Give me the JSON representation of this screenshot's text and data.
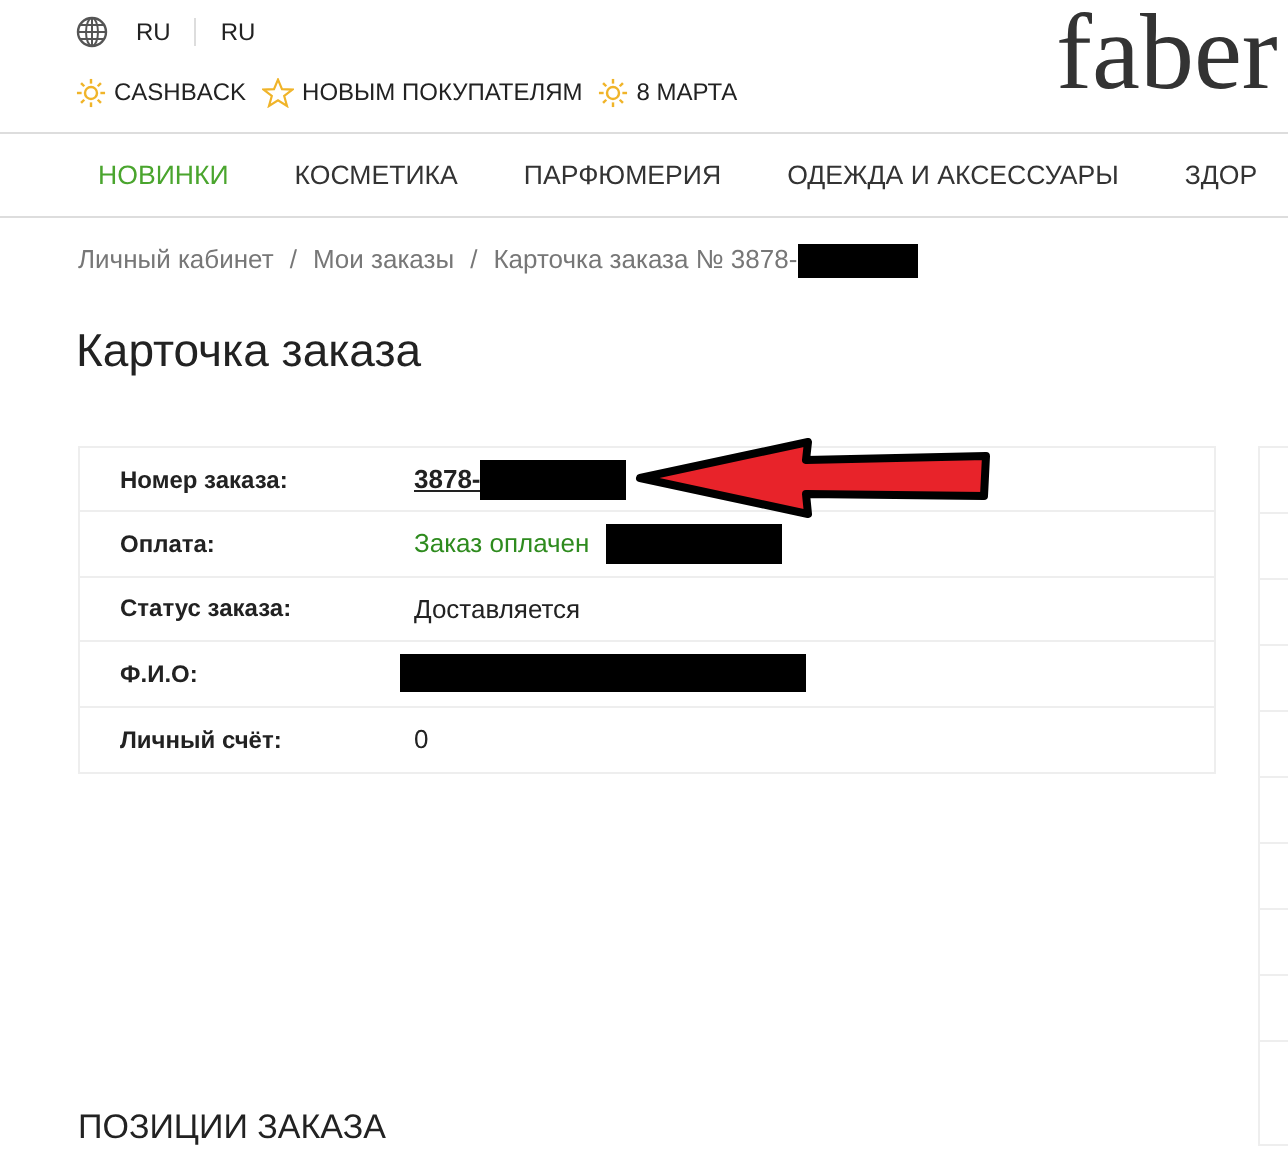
{
  "header": {
    "languages": [
      "RU",
      "RU"
    ],
    "promos": [
      {
        "label": "CASHBACK",
        "kind": "sun"
      },
      {
        "label": "НОВЫМ ПОКУПАТЕЛЯМ",
        "kind": "star"
      },
      {
        "label": "8 МАРТА",
        "kind": "sun"
      }
    ],
    "logo": "faber"
  },
  "nav": [
    {
      "label": "НОВИНКИ",
      "selected": true
    },
    {
      "label": "КОСМЕТИКА",
      "selected": false
    },
    {
      "label": "ПАРФЮМЕРИЯ",
      "selected": false
    },
    {
      "label": "ОДЕЖДА И АКСЕССУАРЫ",
      "selected": false
    },
    {
      "label": "ЗДОР",
      "selected": false
    }
  ],
  "breadcrumb": [
    {
      "label": "Личный кабинет",
      "redacted": false
    },
    {
      "separator": "/",
      "label": "Мои заказы",
      "redacted": false
    },
    {
      "separator": "/",
      "label": "Карточка заказа № 3878-",
      "redacted": true
    }
  ],
  "title": "Карточка заказа",
  "order": [
    {
      "label": "Номер заказа:",
      "value": "3878-",
      "kind": "link",
      "redacted": true,
      "arrow": true
    },
    {
      "label": "Оплата:",
      "value": "Заказ оплачен",
      "kind": "paid",
      "redacted": true,
      "arrow": false
    },
    {
      "label": "Статус заказа:",
      "value": "Доставляется",
      "kind": "text",
      "redacted": false,
      "arrow": false
    },
    {
      "label": "Ф.И.О:",
      "kind": "text",
      "redacted": true,
      "arrow": false
    },
    {
      "label": "Личный счёт:",
      "value": "0",
      "kind": "text",
      "redacted": false,
      "arrow": false
    }
  ],
  "section_heading": "ПОЗИЦИИ ЗАКАЗА"
}
